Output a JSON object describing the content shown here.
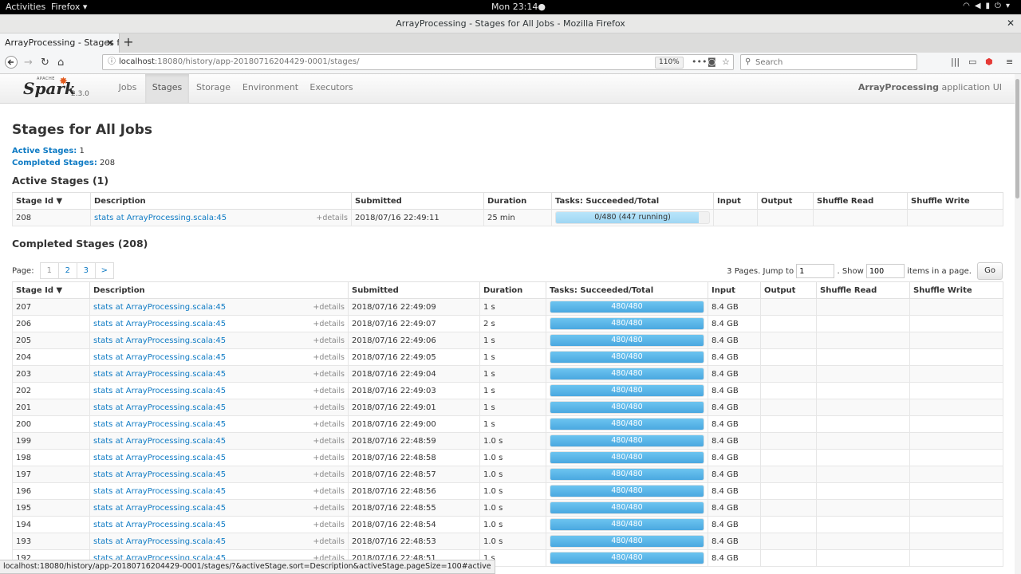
{
  "gnome": {
    "activities": "Activities",
    "app_menu": "Firefox ▾",
    "clock": "Mon 23:14●"
  },
  "window": {
    "title": "ArrayProcessing - Stages for All Jobs - Mozilla Firefox"
  },
  "tabs": [
    {
      "label": "ArrayProcessing - Stages for"
    }
  ],
  "toolbar": {
    "url_host": "localhost",
    "url_rest": ":18080/history/app-20180716204429-0001/stages/",
    "zoom": "110%",
    "search_placeholder": "Search"
  },
  "spark": {
    "version": "2.3.0",
    "apache": "APACHE",
    "logo_text": "Spark",
    "nav": [
      "Jobs",
      "Stages",
      "Storage",
      "Environment",
      "Executors"
    ],
    "active_nav": "Stages",
    "app_name": "ArrayProcessing",
    "app_suffix": " application UI"
  },
  "page": {
    "title": "Stages for All Jobs",
    "active_label": "Active Stages:",
    "active_count": " 1",
    "completed_label": "Completed Stages:",
    "completed_count": " 208",
    "active_heading": "Active Stages (1)",
    "completed_heading": "Completed Stages (208)"
  },
  "columns": [
    "Stage Id ▼",
    "Description",
    "Submitted",
    "Duration",
    "Tasks: Succeeded/Total",
    "Input",
    "Output",
    "Shuffle Read",
    "Shuffle Write"
  ],
  "active_rows": [
    {
      "id": "208",
      "desc": "stats at ArrayProcessing.scala:45",
      "details": "+details",
      "submitted": "2018/07/16 22:49:11",
      "duration": "25 min",
      "tasks": "0/480 (447 running)",
      "progress": 0.93,
      "input": "",
      "output": "",
      "shuffle_read": "",
      "shuffle_write": ""
    }
  ],
  "pagination": {
    "label": "Page:",
    "pages": [
      "1",
      "2",
      "3",
      ">"
    ],
    "jump_text": "3 Pages. Jump to",
    "jump_value": "1",
    "show_text": ". Show",
    "show_value": "100",
    "items_text": "items in a page.",
    "go": "Go"
  },
  "completed_rows": [
    {
      "id": "207",
      "submitted": "2018/07/16 22:49:09",
      "duration": "1 s"
    },
    {
      "id": "206",
      "submitted": "2018/07/16 22:49:07",
      "duration": "2 s"
    },
    {
      "id": "205",
      "submitted": "2018/07/16 22:49:06",
      "duration": "1 s"
    },
    {
      "id": "204",
      "submitted": "2018/07/16 22:49:05",
      "duration": "1 s"
    },
    {
      "id": "203",
      "submitted": "2018/07/16 22:49:04",
      "duration": "1 s"
    },
    {
      "id": "202",
      "submitted": "2018/07/16 22:49:03",
      "duration": "1 s"
    },
    {
      "id": "201",
      "submitted": "2018/07/16 22:49:01",
      "duration": "1 s"
    },
    {
      "id": "200",
      "submitted": "2018/07/16 22:49:00",
      "duration": "1 s"
    },
    {
      "id": "199",
      "submitted": "2018/07/16 22:48:59",
      "duration": "1.0 s"
    },
    {
      "id": "198",
      "submitted": "2018/07/16 22:48:58",
      "duration": "1.0 s"
    },
    {
      "id": "197",
      "submitted": "2018/07/16 22:48:57",
      "duration": "1.0 s"
    },
    {
      "id": "196",
      "submitted": "2018/07/16 22:48:56",
      "duration": "1.0 s"
    },
    {
      "id": "195",
      "submitted": "2018/07/16 22:48:55",
      "duration": "1.0 s"
    },
    {
      "id": "194",
      "submitted": "2018/07/16 22:48:54",
      "duration": "1.0 s"
    },
    {
      "id": "193",
      "submitted": "2018/07/16 22:48:53",
      "duration": "1.0 s"
    },
    {
      "id": "192",
      "submitted": "2018/07/16 22:48:51",
      "duration": "1 s"
    }
  ],
  "completed_common": {
    "desc": "stats at ArrayProcessing.scala:45",
    "details": "+details",
    "tasks": "480/480",
    "input": "8.4 GB"
  },
  "status_url": "localhost:18080/history/app-20180716204429-0001/stages/?&activeStage.sort=Description&activeStage.pageSize=100#active"
}
